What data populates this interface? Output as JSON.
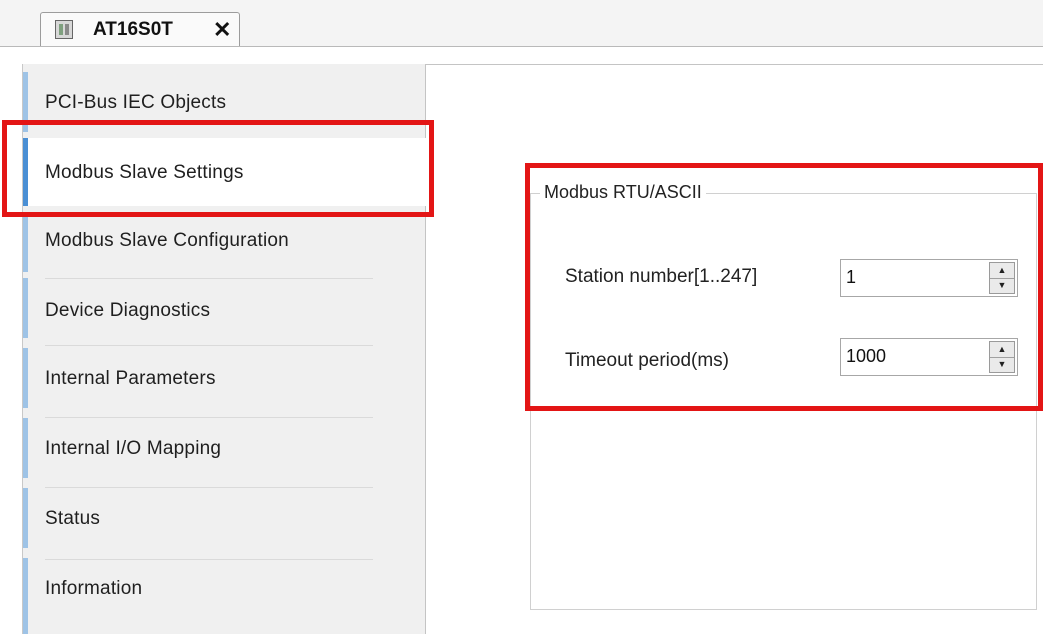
{
  "tab": {
    "title": "AT16S0T",
    "close_glyph": "✕",
    "icon": "device-icon"
  },
  "sidebar": {
    "items": [
      {
        "label": "PCI-Bus IEC Objects",
        "selected": false
      },
      {
        "label": "Modbus Slave Settings",
        "selected": true
      },
      {
        "label": "Modbus Slave Configuration",
        "selected": false
      },
      {
        "label": "Device Diagnostics",
        "selected": false
      },
      {
        "label": "Internal Parameters",
        "selected": false
      },
      {
        "label": "Internal I/O Mapping",
        "selected": false
      },
      {
        "label": "Status",
        "selected": false
      },
      {
        "label": "Information",
        "selected": false
      }
    ]
  },
  "settings": {
    "group_title": "Modbus RTU/ASCII",
    "fields": [
      {
        "label": "Station number[1..247]",
        "value": "1"
      },
      {
        "label": "Timeout period(ms)",
        "value": "1000"
      }
    ]
  },
  "colors": {
    "highlight": "#e31515",
    "selected_stripe": "#4a8fd4",
    "stripe": "#9ec3e6"
  }
}
